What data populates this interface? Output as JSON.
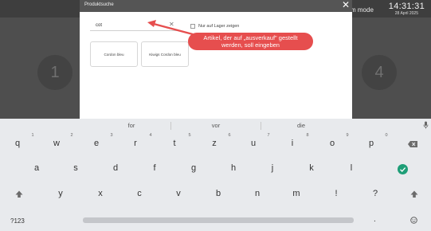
{
  "background": {
    "mode_label": "m mode",
    "clock_time": "14:31:31",
    "clock_date": "28 April 2025",
    "step_left": "1",
    "step_right": "4"
  },
  "modal": {
    "title": "Produktsuche",
    "close_icon": "close-icon",
    "search": {
      "value": "cot",
      "clear_symbol": "✕"
    },
    "stock_filter": {
      "label": "Nur auf Lager zeigen",
      "checked": false
    },
    "products": [
      "Cordon bleu",
      "Kiwigs Cordon bleu"
    ]
  },
  "annotation": {
    "text_line1": "Artikel, der auf „ausverkauf\" gestellt",
    "text_line2": "werden, soll eingeben",
    "color": "#e64e4e"
  },
  "keyboard": {
    "suggestions": [
      "for",
      "vor",
      "die"
    ],
    "number_hints": [
      "1",
      "2",
      "3",
      "4",
      "5",
      "6",
      "7",
      "8",
      "9",
      "0"
    ],
    "row1": [
      "q",
      "w",
      "e",
      "r",
      "t",
      "z",
      "u",
      "i",
      "o",
      "p"
    ],
    "row2": [
      "a",
      "s",
      "d",
      "f",
      "g",
      "h",
      "j",
      "k",
      "l"
    ],
    "row3": [
      "y",
      "x",
      "c",
      "v",
      "b",
      "n",
      "m",
      "!",
      "?"
    ],
    "symbols_key": "?123",
    "period_key": ".",
    "accent_color": "#1e9e77"
  }
}
